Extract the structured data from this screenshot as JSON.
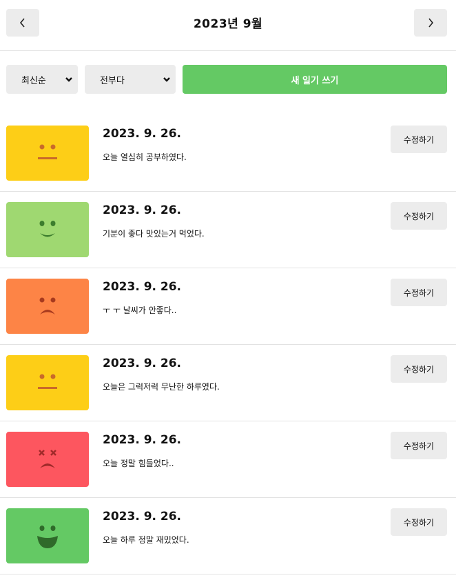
{
  "header": {
    "title": "2023년 9월",
    "prev_label": "<",
    "next_label": ">"
  },
  "controls": {
    "sort_selected": "최신순",
    "filter_selected": "전부다",
    "new_button_label": "새 일기 쓰기"
  },
  "colors": {
    "emotion_1": "#64c964",
    "emotion_2": "#9fd871",
    "emotion_3": "#fdce17",
    "emotion_4": "#fd8446",
    "emotion_5": "#fd565f",
    "accent_green": "#64c964"
  },
  "entries": [
    {
      "date": "2023. 9. 26.",
      "content": "오늘 열심히 공부하였다.",
      "emotion_icon": "neutral-face-icon",
      "edit_label": "수정하기"
    },
    {
      "date": "2023. 9. 26.",
      "content": "기분이 좋다 맛있는거 먹었다.",
      "emotion_icon": "smile-face-icon",
      "edit_label": "수정하기"
    },
    {
      "date": "2023. 9. 26.",
      "content": "ㅜ ㅜ 날씨가 안좋다..",
      "emotion_icon": "frown-face-icon",
      "edit_label": "수정하기"
    },
    {
      "date": "2023. 9. 26.",
      "content": "오늘은 그럭저럭 무난한 하루였다.",
      "emotion_icon": "neutral-face-icon",
      "edit_label": "수정하기"
    },
    {
      "date": "2023. 9. 26.",
      "content": "오늘 정말 힘들었다..",
      "emotion_icon": "dizzy-face-icon",
      "edit_label": "수정하기"
    },
    {
      "date": "2023. 9. 26.",
      "content": "오늘 하루 정말 재밌었다.",
      "emotion_icon": "laugh-face-icon",
      "edit_label": "수정하기"
    }
  ]
}
